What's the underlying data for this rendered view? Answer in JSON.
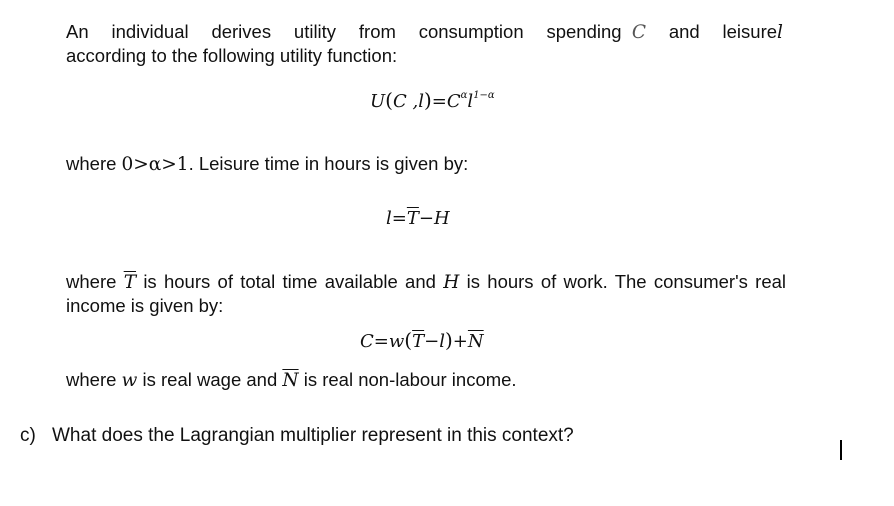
{
  "document": {
    "intro": {
      "line1_words": [
        "An",
        "individual",
        "derives",
        "utility",
        "from",
        "consumption",
        "spending"
      ],
      "var_C": "C",
      "and": "and",
      "leisure_word": "leisure",
      "var_l": "l",
      "line2": "according to the following utility function:"
    },
    "utility_formula": {
      "lhs": "U",
      "args": "C ,l",
      "eq": "=",
      "base1": "C",
      "exp1": "α",
      "base2": "l",
      "exp2": "1−α"
    },
    "alpha_condition": {
      "prefix": "where ",
      "condition": "0>α>1",
      "suffix": ".  Leisure time in hours is given by:"
    },
    "leisure_formula": {
      "lhs": "l",
      "eq": "=",
      "T": "T",
      "minus": "−",
      "H": "H"
    },
    "time_definition": {
      "part1": "where ",
      "T": "T",
      "part2": " is hours of total time available and ",
      "H": "H",
      "part3": " is hours of work. The consumer's real income is given by:"
    },
    "income_formula": {
      "lhs": "C",
      "eq": "=",
      "w": "w",
      "open": "(",
      "T": "T",
      "minus": "−",
      "l": "l",
      "close": ")",
      "plus": "+",
      "N": "N"
    },
    "wage_definition": {
      "part1": "where ",
      "w": "w",
      "part2": " is real wage and ",
      "N": "N",
      "part3": " is real non-labour income."
    },
    "question": {
      "label": "c)",
      "text": "What does the Lagrangian multiplier represent in this context?"
    }
  }
}
